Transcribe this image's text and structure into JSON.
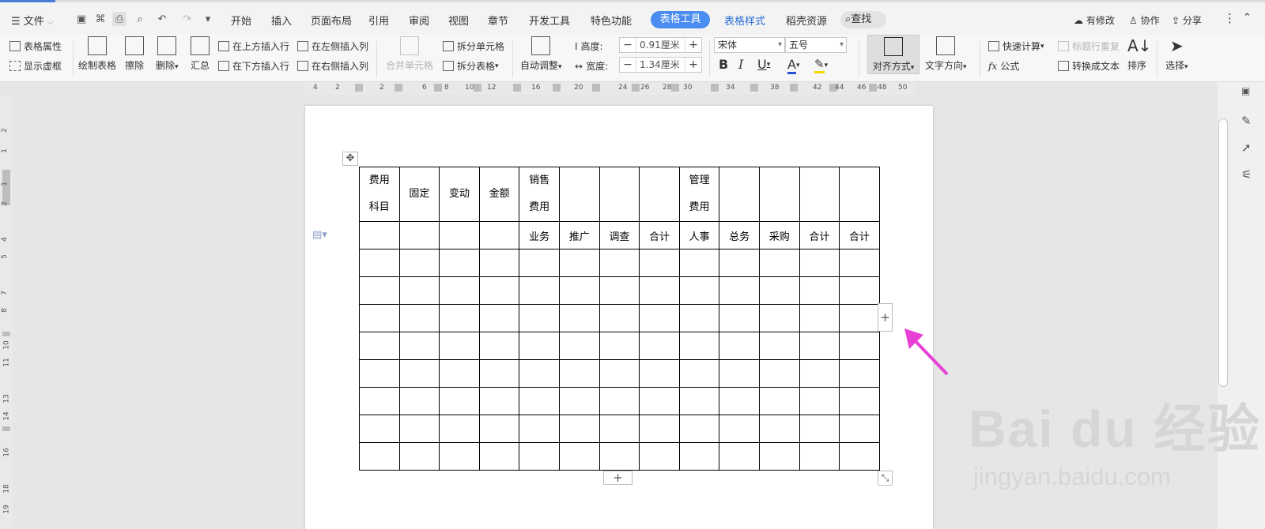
{
  "menu": {
    "file": "文件",
    "tabs": [
      "开始",
      "插入",
      "页面布局",
      "引用",
      "审阅",
      "视图",
      "章节",
      "开发工具",
      "特色功能"
    ],
    "active_tab": "表格工具",
    "tab_table_style": "表格样式",
    "tab_resources": "稻壳资源",
    "search": "查找",
    "modified": "有修改",
    "collab": "协作",
    "share": "分享"
  },
  "ribbon": {
    "table_props": "表格属性",
    "show_gridlines": "显示虚框",
    "draw_table": "绘制表格",
    "erase": "擦除",
    "delete": "删除",
    "summary": "汇总",
    "insert_above": "在上方插入行",
    "insert_below": "在下方插入行",
    "insert_left": "在左侧插入列",
    "insert_right": "在右侧插入列",
    "merge_cells": "合并单元格",
    "split_cells": "拆分单元格",
    "split_table": "拆分表格",
    "auto_fit": "自动调整",
    "height_label": "高度:",
    "height_value": "0.91厘米",
    "width_label": "宽度:",
    "width_value": "1.34厘米",
    "font_name": "宋体",
    "font_size": "五号",
    "bold": "B",
    "italic": "I",
    "underline": "U",
    "font_color": "A",
    "align": "对齐方式",
    "text_direction": "文字方向",
    "quick_calc": "快速计算",
    "repeat_header": "标题行重复",
    "formula": "公式",
    "to_text": "转换成文本",
    "sort": "排序",
    "select": "选择"
  },
  "ruler": {
    "h": [
      "4",
      "2",
      "2",
      "6",
      "8",
      "10",
      "12",
      "16",
      "20",
      "24",
      "26",
      "28",
      "30",
      "34",
      "38",
      "42",
      "44",
      "46",
      "48",
      "50"
    ],
    "v": [
      "2",
      "1",
      "1",
      "2",
      "4",
      "5",
      "7",
      "8",
      "10",
      "11",
      "13",
      "14",
      "16",
      "18",
      "19"
    ]
  },
  "table": {
    "header_row": [
      "费用\n科目",
      "固定",
      "变动",
      "金额",
      "销售\n费用",
      "",
      "",
      "",
      "管理\n费用",
      "",
      "",
      "",
      ""
    ],
    "sub_row": [
      "",
      "",
      "",
      "",
      "业务",
      "推广",
      "调查",
      "合计",
      "人事",
      "总务",
      "采购",
      "合计",
      "合计"
    ],
    "empty_rows": 8
  },
  "watermark": {
    "brand": "Bai du 经验",
    "url": "jingyan.baidu.com"
  },
  "colors": {
    "accent": "#4a8cf0",
    "arrow": "#e83fd6",
    "watermark": "#d6d6d6"
  }
}
